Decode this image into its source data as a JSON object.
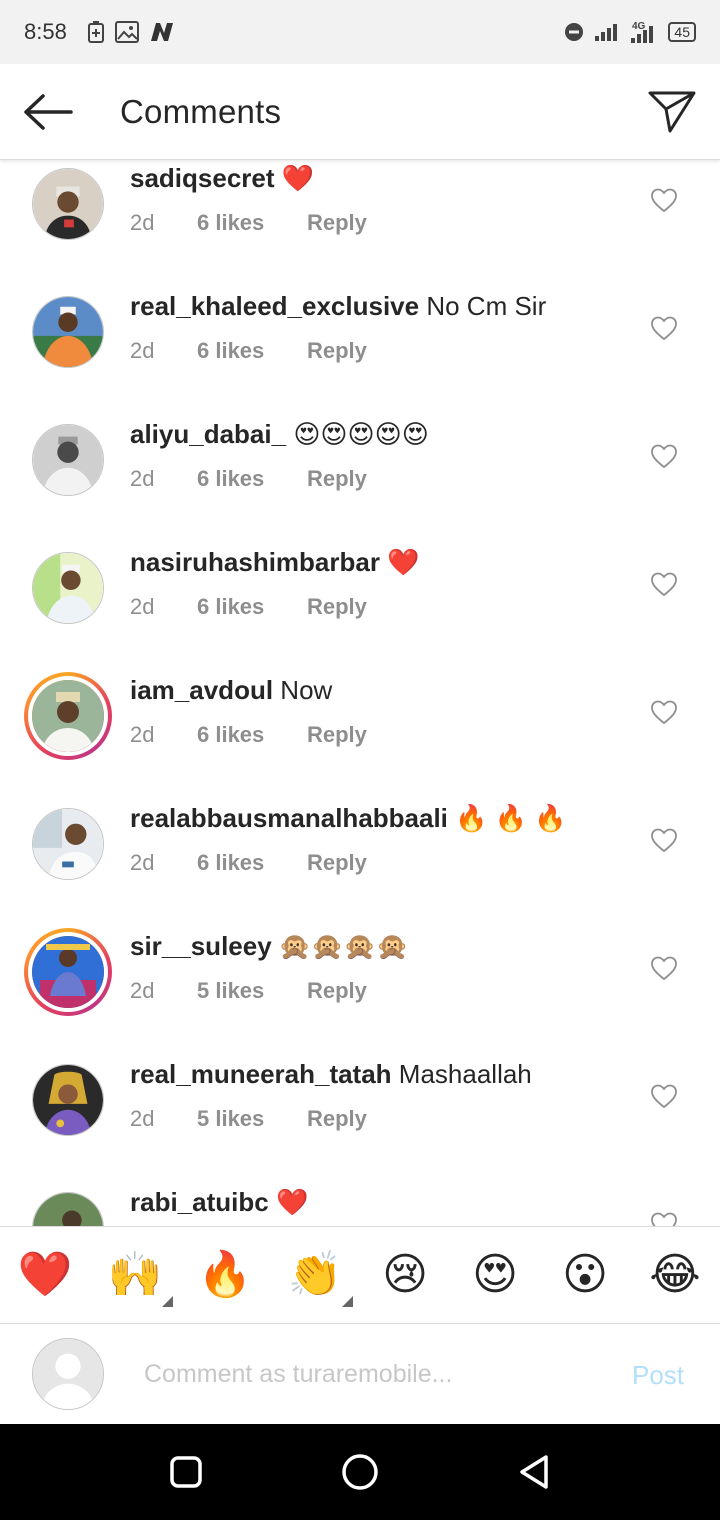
{
  "status_bar": {
    "time": "8:58",
    "network": "4G",
    "battery": "45"
  },
  "header": {
    "title": "Comments"
  },
  "comments": [
    {
      "username": "sadiqsecret",
      "text": "",
      "emoji": "❤️",
      "time": "2d",
      "likes": "6 likes",
      "reply": "Reply"
    },
    {
      "username": "real_khaleed_exclusive",
      "text": "No Cm Sir",
      "emoji": "",
      "time": "2d",
      "likes": "6 likes",
      "reply": "Reply"
    },
    {
      "username": "aliyu_dabai_",
      "text": "",
      "emoji": "😍😍😍😍😍",
      "time": "2d",
      "likes": "6 likes",
      "reply": "Reply"
    },
    {
      "username": "nasiruhashimbarbar",
      "text": "",
      "emoji": "❤️",
      "time": "2d",
      "likes": "6 likes",
      "reply": "Reply"
    },
    {
      "username": "iam_avdoul",
      "text": "Now",
      "emoji": "",
      "time": "2d",
      "likes": "6 likes",
      "reply": "Reply"
    },
    {
      "username": "realabbausmanalhabbaali",
      "text": "",
      "emoji": "🔥 🔥 🔥",
      "time": "2d",
      "likes": "6 likes",
      "reply": "Reply"
    },
    {
      "username": "sir__suleey",
      "text": "",
      "emoji": "🙊🙊🙊🙊",
      "time": "2d",
      "likes": "5 likes",
      "reply": "Reply"
    },
    {
      "username": "real_muneerah_tatah",
      "text": "Mashaallah",
      "emoji": "",
      "time": "2d",
      "likes": "5 likes",
      "reply": "Reply"
    },
    {
      "username": "rabi_atuibc",
      "text": "",
      "emoji": "❤️",
      "time": "",
      "likes": "",
      "reply": ""
    }
  ],
  "reactions": [
    "❤️",
    "🙌",
    "🔥",
    "👏",
    "😢",
    "😍",
    "😮",
    "😂"
  ],
  "composer": {
    "placeholder": "Comment as turaremobile...",
    "post_label": "Post"
  },
  "colors": {
    "accent_disabled": "#b2dffc",
    "secondary_text": "#8e8e8e",
    "primary_text": "#262626"
  }
}
